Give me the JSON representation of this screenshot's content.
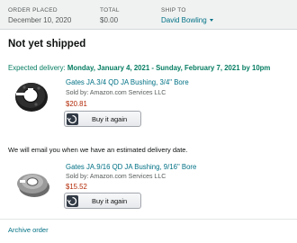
{
  "order_header": {
    "order_placed_label": "ORDER PLACED",
    "order_placed_value": "December 10, 2020",
    "total_label": "TOTAL",
    "total_value": "$0.00",
    "ship_to_label": "SHIP TO",
    "ship_to_value": "David Bowling"
  },
  "shipment": {
    "status": "Not yet shipped",
    "expected_prefix": "Expected delivery: ",
    "expected_dates": "Monday, January 4, 2021 - Sunday, February 7, 2021 by 10pm",
    "notice": "We will email you when we have an estimated delivery date."
  },
  "items": [
    {
      "title": "Gates JA.3/4 QD JA Bushing, 3/4\" Bore",
      "seller": "Sold by: Amazon.com Services LLC",
      "price": "$20.81",
      "buy_label": "Buy it again"
    },
    {
      "title": "Gates JA.9/16 QD JA Bushing, 9/16\" Bore",
      "seller": "Sold by: Amazon.com Services LLC",
      "price": "$15.52",
      "buy_label": "Buy it again"
    }
  ],
  "footer": {
    "archive_label": "Archive order"
  },
  "colors": {
    "link": "#007185",
    "delivery_green": "#067d62",
    "price_red": "#b12704",
    "header_bg": "#f0f2f2"
  }
}
